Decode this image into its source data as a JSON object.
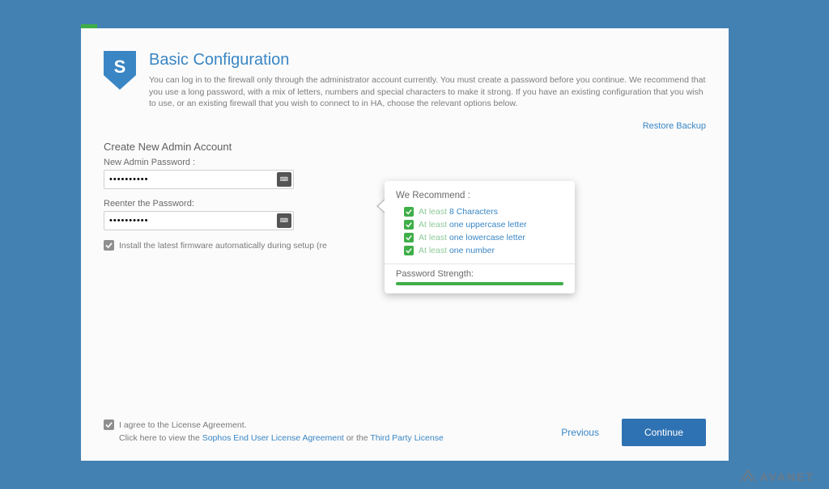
{
  "header": {
    "title": "Basic Configuration",
    "description": "You can log in to the firewall only through the administrator account currently. You must create a password before you continue. We recommend that you use a long password, with a mix of letters, numbers and special characters to make it strong. If you have an existing configuration that you wish to use, or an existing firewall that you wish to connect to in HA, choose the relevant options below.",
    "restore_link": "Restore Backup"
  },
  "account": {
    "section_title": "Create New Admin Account",
    "password_label": "New Admin Password :",
    "password_value": "••••••••••",
    "reenter_label": "Reenter the Password:",
    "reenter_value": "••••••••••",
    "firmware_checkbox": "Install the latest firmware automatically during setup (re"
  },
  "tooltip": {
    "title": "We Recommend :",
    "reqs": [
      {
        "prefix": "At least  ",
        "em": "8 Characters"
      },
      {
        "prefix": "At least  ",
        "em": "one uppercase letter"
      },
      {
        "prefix": "At least  ",
        "em": "one lowercase letter"
      },
      {
        "prefix": "At least  ",
        "em": "one number"
      }
    ],
    "strength_label": "Password Strength:"
  },
  "footer": {
    "agree_label": "I agree to the License Agreement.",
    "view_prefix": "Click here to view the ",
    "eula_link": "Sophos End User License Agreement",
    "or_text": " or the ",
    "third_party_link": "Third Party License",
    "previous": "Previous",
    "continue": "Continue"
  },
  "brand": "AVANET"
}
